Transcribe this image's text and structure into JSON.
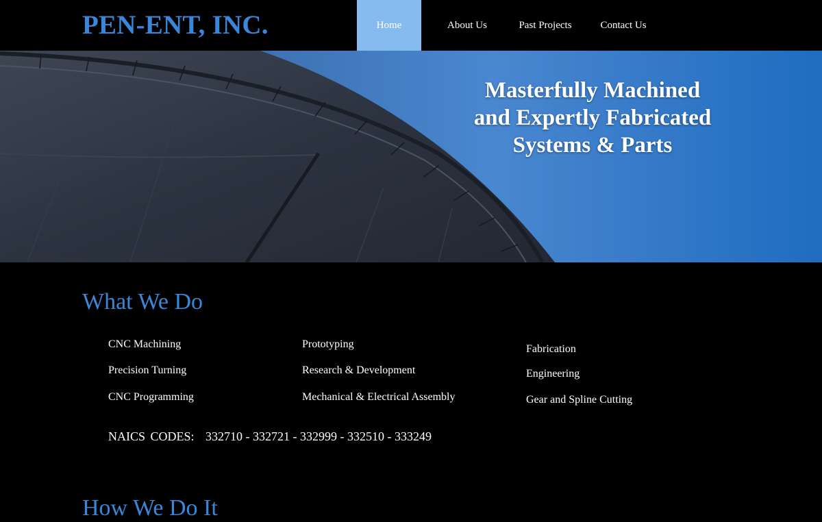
{
  "header": {
    "logo": "PEN-ENT, INC.",
    "nav": [
      {
        "label": "Home",
        "active": true
      },
      {
        "label": "About Us",
        "active": false
      },
      {
        "label": "Past Projects",
        "active": false
      },
      {
        "label": "Contact Us",
        "active": false
      }
    ]
  },
  "hero": {
    "lines": [
      "Masterfully Machined",
      "and Expertly Fabricated",
      "Systems & Parts"
    ]
  },
  "what_we_do": {
    "title": "What We Do",
    "col1": [
      "CNC Machining",
      "Precision Turning",
      "CNC Programming"
    ],
    "col2": [
      "Prototyping",
      "Research & Development",
      "Mechanical & Electrical Assembly"
    ],
    "col3": [
      "Fabrication",
      "Engineering",
      "Gear and Spline Cutting"
    ],
    "naics_label": "NAICS CODES:",
    "naics_codes": "332710 - 332721 - 332999 - 332510 - 333249"
  },
  "how_we_do_it": {
    "title": "How We Do It"
  },
  "colors": {
    "accent": "#3a86d8",
    "nav_active": "#86bbef",
    "background": "#000000",
    "text": "#ffffff"
  }
}
